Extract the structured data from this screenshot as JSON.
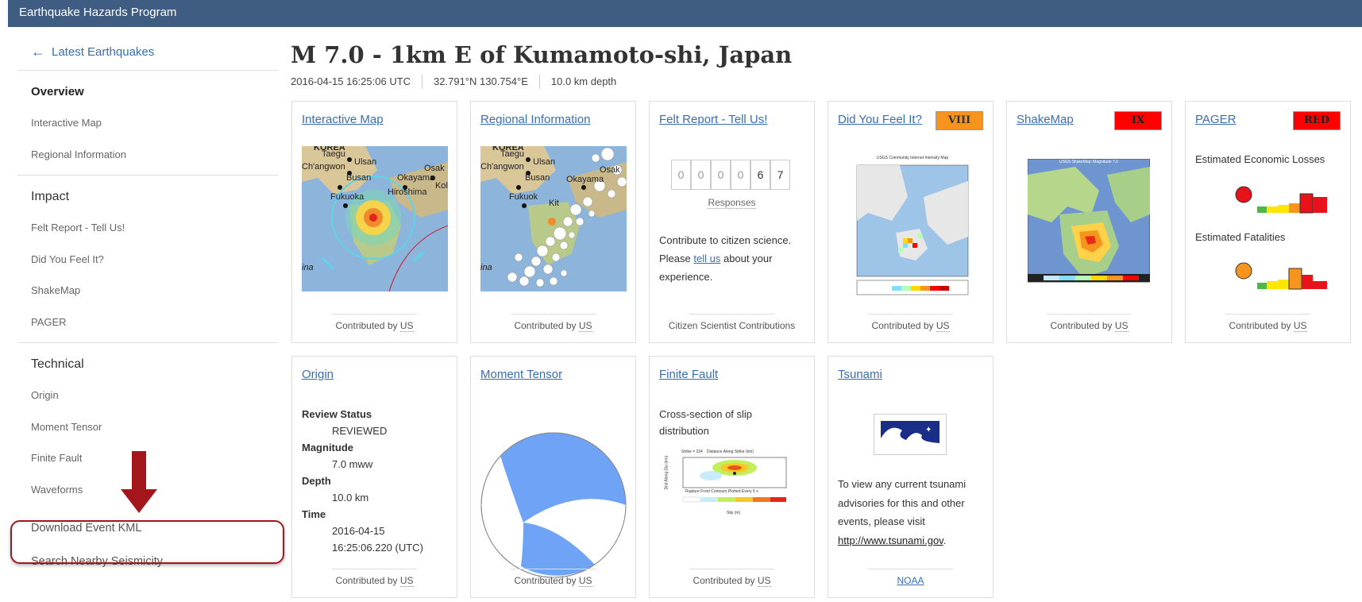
{
  "app": {
    "brand": "Earthquake Hazards Program"
  },
  "sidebar": {
    "back": {
      "arrow": "←",
      "label": "Latest Earthquakes"
    },
    "overview": "Overview",
    "overview_items": [
      "Interactive Map",
      "Regional Information"
    ],
    "impact": "Impact",
    "impact_items": [
      "Felt Report - Tell Us!",
      "Did You Feel It?",
      "ShakeMap",
      "PAGER"
    ],
    "technical": "Technical",
    "technical_items": [
      "Origin",
      "Moment Tensor",
      "Finite Fault",
      "Waveforms"
    ],
    "download": "Download Event KML",
    "nearby": "Search Nearby Seismicity"
  },
  "event": {
    "title": "M 7.0 - 1km E of Kumamoto-shi, Japan",
    "time": "2016-04-15 16:25:06 UTC",
    "coords": "32.791°N  130.754°E",
    "depth": "10.0 km depth"
  },
  "cards": {
    "interactive_map": {
      "title": "Interactive Map",
      "contrib": "Contributed by",
      "src": "US",
      "labels": [
        "KOREA",
        "Taegu",
        "Ch'angwon",
        "Ulsan",
        "Busan",
        "Okayama",
        "Osak",
        "Fukuoka",
        "Hiroshima",
        "Kol",
        "ina"
      ]
    },
    "regional": {
      "title": "Regional Information",
      "contrib": "Contributed by",
      "src": "US",
      "labels": [
        "KOREA",
        "Taegu",
        "Ch'angwon",
        "Ulsan",
        "Busan",
        "Okayama",
        "Osak",
        "Fukuok",
        "Kit",
        "ina"
      ]
    },
    "felt": {
      "title": "Felt Report - Tell Us!",
      "digits": [
        "0",
        "0",
        "0",
        "0",
        "6",
        "7"
      ],
      "responses": "Responses",
      "line1": "Contribute to citizen science.",
      "please": "Please",
      "link": "tell us",
      "after": "about your",
      "line3": "experience.",
      "foot": "Citizen Scientist Contributions"
    },
    "dyfi": {
      "title": "Did You Feel It?",
      "badge": "VIII",
      "badge_color": "#f7941d",
      "contrib": "Contributed by",
      "src": "US",
      "map_title": "USGS Community Internet Intensity Map"
    },
    "shakemap": {
      "title": "ShakeMap",
      "badge": "IX",
      "badge_color": "#ff0000",
      "contrib": "Contributed by",
      "src": "US",
      "map_title": "USGS ShakeMap: Magnitude 7.0"
    },
    "pager": {
      "title": "PAGER",
      "badge": "RED",
      "badge_color": "#ff0000",
      "contrib": "Contributed by",
      "src": "US",
      "losses": "Estimated Economic Losses",
      "fatalities": "Estimated Fatalities",
      "losses_color": "#e8121a",
      "fatalities_color": "#f7941d"
    },
    "origin": {
      "title": "Origin",
      "contrib": "Contributed by",
      "src": "US",
      "fields": [
        {
          "k": "Review Status",
          "v": "REVIEWED"
        },
        {
          "k": "Magnitude",
          "v": "7.0 mww"
        },
        {
          "k": "Depth",
          "v": "10.0 km"
        },
        {
          "k": "Time",
          "v": "2016-04-15",
          "v2": "16:25:06.220 (UTC)"
        }
      ]
    },
    "moment": {
      "title": "Moment Tensor",
      "contrib": "Contributed by",
      "src": "US"
    },
    "finite": {
      "title": "Finite Fault",
      "desc": "Cross-section of slip distribution",
      "contrib": "Contributed by",
      "src": "US",
      "plot_title": "Distance Along Strike (km)",
      "plot_foot": "Rupture Front Contours Plotted Every 5 s",
      "xlabel": "Slip (m)",
      "strike": "Strike = 224",
      "ylabel": "Dist Along Dip (km)"
    },
    "tsunami": {
      "title": "Tsunami",
      "desc1": "To view any current tsunami advisories for this and other events, please visit",
      "link": "http://www.tsunami.gov",
      "period": ".",
      "foot": "NOAA"
    }
  }
}
